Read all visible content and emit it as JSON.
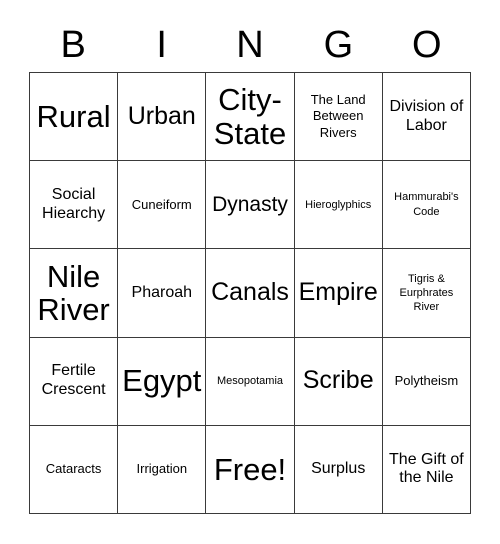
{
  "card": {
    "title": "BINGO",
    "header_letters": [
      "B",
      "I",
      "N",
      "G",
      "O"
    ],
    "free_space_label": "Free!",
    "colors": {
      "background": "#ffffff",
      "border": "#3a3a3a",
      "text": "#000000"
    },
    "grid": {
      "columns": 5,
      "rows": 5,
      "cells": [
        {
          "text": "Rural",
          "size": "sz-xl"
        },
        {
          "text": "Urban",
          "size": "sz-lg"
        },
        {
          "text": "City-State",
          "size": "sz-xl"
        },
        {
          "text": "The Land Between Rivers",
          "size": "sz-xs"
        },
        {
          "text": "Division of Labor",
          "size": "sz-sm"
        },
        {
          "text": "Social Hiearchy",
          "size": "sz-sm"
        },
        {
          "text": "Cuneiform",
          "size": "sz-xs"
        },
        {
          "text": "Dynasty",
          "size": "sz-md"
        },
        {
          "text": "Hieroglyphics",
          "size": "sz-xxs"
        },
        {
          "text": "Hammurabi's Code",
          "size": "sz-xxs"
        },
        {
          "text": "Nile River",
          "size": "sz-xl"
        },
        {
          "text": "Pharoah",
          "size": "sz-sm"
        },
        {
          "text": "Canals",
          "size": "sz-lg"
        },
        {
          "text": "Empire",
          "size": "sz-lg"
        },
        {
          "text": "Tigris & Eurphrates River",
          "size": "sz-xxs"
        },
        {
          "text": "Fertile Crescent",
          "size": "sz-sm"
        },
        {
          "text": "Egypt",
          "size": "sz-xl"
        },
        {
          "text": "Mesopotamia",
          "size": "sz-xxs"
        },
        {
          "text": "Scribe",
          "size": "sz-lg"
        },
        {
          "text": "Polytheism",
          "size": "sz-xs"
        },
        {
          "text": "Cataracts",
          "size": "sz-xs"
        },
        {
          "text": "Irrigation",
          "size": "sz-xs"
        },
        {
          "text": "Free!",
          "size": "sz-xl"
        },
        {
          "text": "Surplus",
          "size": "sz-sm"
        },
        {
          "text": "The Gift of the Nile",
          "size": "sz-sm"
        }
      ]
    }
  }
}
